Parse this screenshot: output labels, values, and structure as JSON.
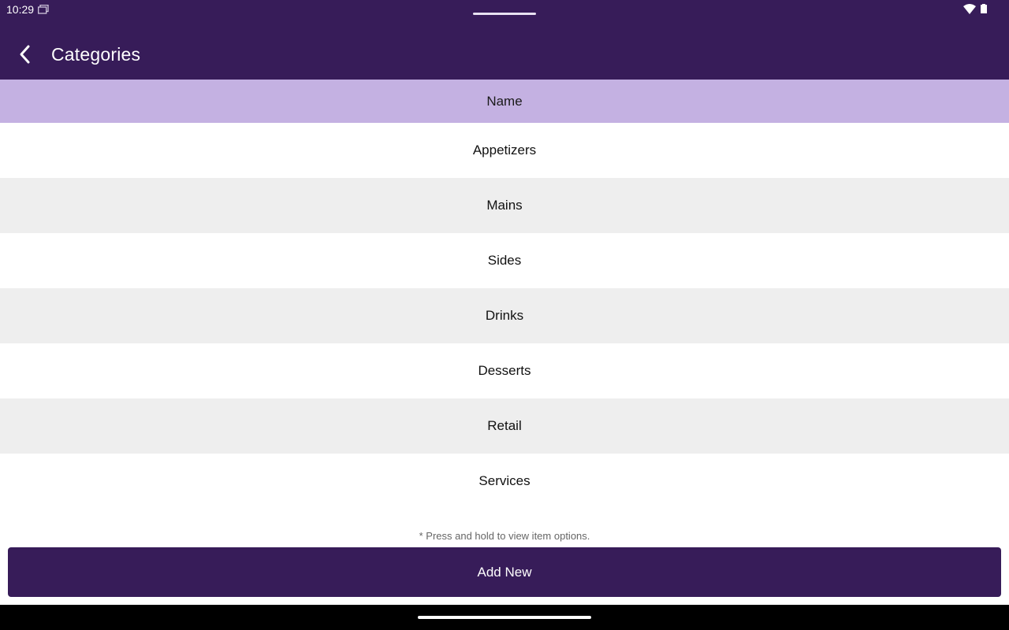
{
  "status_bar": {
    "time": "10:29",
    "icons": [
      "notification-icon",
      "wifi-icon",
      "battery-icon"
    ]
  },
  "app_bar": {
    "title": "Categories",
    "back_icon": "chevron-left-icon"
  },
  "table": {
    "header": "Name",
    "rows": [
      "Appetizers",
      "Mains",
      "Sides",
      "Drinks",
      "Desserts",
      "Retail",
      "Services"
    ]
  },
  "hint": "* Press and hold to view item options.",
  "add_button_label": "Add New",
  "colors": {
    "primary": "#371c59",
    "header_bg": "#c4b1e2",
    "row_alt": "#eeeeee"
  }
}
